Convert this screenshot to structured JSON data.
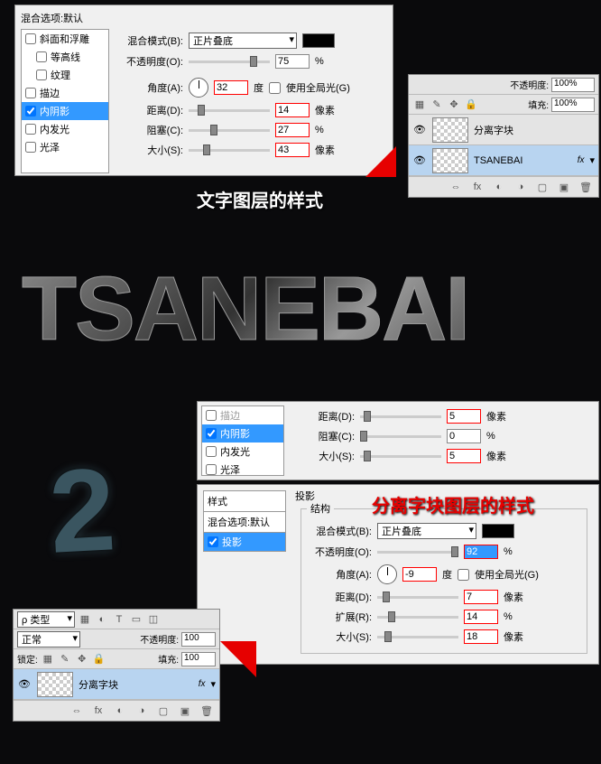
{
  "panel1": {
    "title": "混合选项:默认",
    "styles": [
      {
        "label": "斜面和浮雕",
        "checked": false
      },
      {
        "label": "等高线",
        "checked": false,
        "indent": true
      },
      {
        "label": "纹理",
        "checked": false,
        "indent": true
      },
      {
        "label": "描边",
        "checked": false
      },
      {
        "label": "内阴影",
        "checked": true,
        "selected": true
      },
      {
        "label": "内发光",
        "checked": false
      },
      {
        "label": "光泽",
        "checked": false
      }
    ],
    "form": {
      "blend_label": "混合模式(B):",
      "blend_value": "正片叠底",
      "opacity_label": "不透明度(O):",
      "opacity_value": "75",
      "opacity_unit": "%",
      "angle_label": "角度(A):",
      "angle_value": "32",
      "angle_unit": "度",
      "global_label": "使用全局光(G)",
      "distance_label": "距离(D):",
      "distance_value": "14",
      "distance_unit": "像素",
      "choke_label": "阻塞(C):",
      "choke_value": "27",
      "choke_unit": "%",
      "size_label": "大小(S):",
      "size_value": "43",
      "size_unit": "像素"
    }
  },
  "banner1": "文字图层的样式",
  "layers1": {
    "opacity_label": "不透明度:",
    "opacity_value": "100%",
    "fill_label": "填充:",
    "fill_value": "100%",
    "rows": [
      {
        "name": "分离字块",
        "selected": false
      },
      {
        "name": "TSANEBAI",
        "selected": true,
        "fx": "fx"
      }
    ]
  },
  "big_text": "TSANEBAI",
  "big_num": "2",
  "panel2a": {
    "styles": [
      {
        "label": "描边",
        "checked": false,
        "dim": true
      },
      {
        "label": "内阴影",
        "checked": true,
        "selected": true
      },
      {
        "label": "内发光",
        "checked": false
      },
      {
        "label": "光泽",
        "checked": false
      }
    ],
    "distance_label": "距离(D):",
    "distance_value": "5",
    "distance_unit": "像素",
    "choke_label": "阻塞(C):",
    "choke_value": "0",
    "choke_unit": "%",
    "size_label": "大小(S):",
    "size_value": "5",
    "size_unit": "像素"
  },
  "panel2b": {
    "sidebar_title": "样式",
    "blend_opts": "混合选项:默认",
    "dropshadow": "投影",
    "section_label": "投影",
    "struct_label": "结构",
    "blend_label": "混合模式(B):",
    "blend_value": "正片叠底",
    "opacity_label": "不透明度(O):",
    "opacity_value": "92",
    "opacity_unit": "%",
    "angle_label": "角度(A):",
    "angle_value": "-9",
    "angle_unit": "度",
    "global_label": "使用全局光(G)",
    "distance_label": "距离(D):",
    "distance_value": "7",
    "distance_unit": "像素",
    "spread_label": "扩展(R):",
    "spread_value": "14",
    "spread_unit": "%",
    "size_label": "大小(S):",
    "size_value": "18",
    "size_unit": "像素"
  },
  "banner2": "分离字块图层的样式",
  "layers2": {
    "kind_label": "ρ 类型",
    "mode_value": "正常",
    "opacity_label": "不透明度:",
    "opacity_value": "100",
    "lock_label": "锁定:",
    "fill_label": "填充:",
    "fill_value": "100",
    "row_name": "分离字块",
    "fx": "fx"
  }
}
